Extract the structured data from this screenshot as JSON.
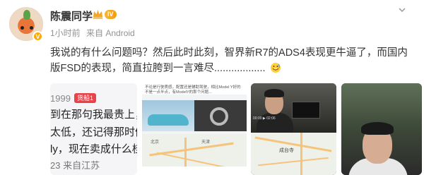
{
  "user": {
    "name": "陈震同学",
    "level": "IV",
    "verified_mark": "V"
  },
  "meta": {
    "time": "1小时前",
    "source": "来自 Android"
  },
  "post": {
    "text": "我说的有什么问题吗？然后此时此刻，智界新R7的ADS4表现更牛逼了，而国内版FSD的表现，简直拉胯到一言难尽..................",
    "emoji": "grin-emoji"
  },
  "photos": {
    "p1": {
      "number": "1999",
      "tag": "货船1",
      "line1": "到在那句我最贵上，",
      "line2": "太低，还记得那时候",
      "line3": "ly，现在卖成什么桂",
      "line4": "23 来自江苏"
    },
    "p2": {
      "article_text": "不论是行驶质感，配置还是辅助驾驶，相比Model Y好的不是一点半点，有ModelY的那个问题...",
      "map_label_left": "北京",
      "map_label_right": "天津"
    },
    "p3": {
      "video_bar": "00:00 ▶ 02:06",
      "map_label": "成台寺"
    }
  },
  "colors": {
    "accent_orange": "#ffa900",
    "meta_gray": "#939393",
    "tag_red": "#e9424a"
  }
}
